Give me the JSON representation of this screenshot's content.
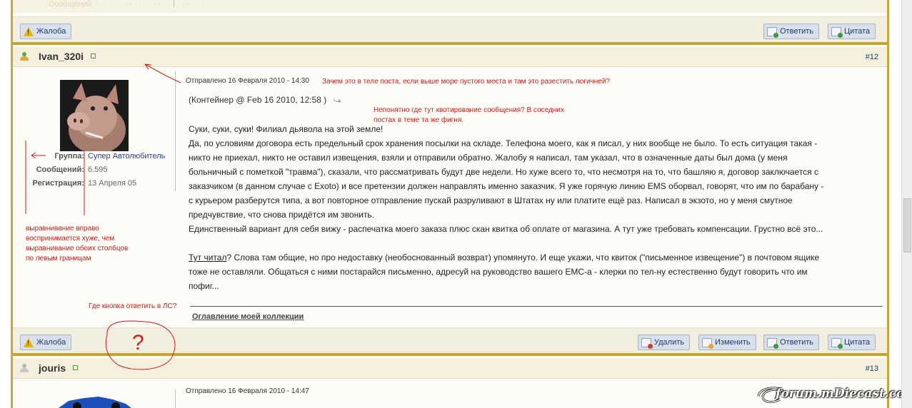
{
  "top_strip": {
    "faint_text": "Сообщений: · · · · · · · · · · · · · · · · · · · · · · · ·"
  },
  "buttons": {
    "complaint": "Жалоба",
    "reply": "Ответить",
    "quote": "Цитата",
    "delete": "Удалить",
    "edit": "Изменить"
  },
  "post12": {
    "username": "Ivan_320i",
    "number": "#12",
    "sent": "Отправлено 16 Февраля 2010 - 14:30",
    "group_label": "Группа:",
    "group_value": "Супер Автолюбитель",
    "posts_label": "Сообщений:",
    "posts_value": "6.595",
    "reg_label": "Регистрация:",
    "reg_value": "13 Апреля 05",
    "quote_header": "(Контейнер @ Feb 16 2010, 12:58 )",
    "lines": [
      "Суки, суки, суки! Филиал дьявола на этой земле!",
      "Да, по условиям договора есть предельный срок хранения посылки на складе. Телефона моего, как я писал, у них вообще не было. То есть ситуация такая -",
      "никто не приехал, никто не оставил извещения, взяли и отправили обратно. Жалобу я написал, там указал, что в означенные даты был дома (у меня",
      "больничный с пометкой \"травма\"), сказали, что рассматривать будут две недели. Но хуже всего то, что несмотря на то, что башляю я, договор заключается с",
      "заказчиком (в данном случае с Exoto) и все претензии должен направлять именно заказчик. Я уже горячую линию EMS оборвал, говорят, что им по барабану -",
      "с курьером разберутся типа, а вот повторное отправление пускай разруливают в Штатах ну или платите ещё раз. Написал в экзото, но у меня смутное",
      "предчувствие, что снова придётся им звонить.",
      "Единственный вариант для себя вижу - распечатка моего заказа плюс скан квитка об оплате от магазина. А тут уже требовать компенсации. Грустно всё это..."
    ],
    "reply_link": "Тут читал",
    "reply_line1_rest": "? Слова там общие, но про недоставку (необоснованный возврат) упомянуто. И еще укажи, что квиток (\"письменное извещение\") в почтовом ящике",
    "reply_line2": "тоже не оставляли. Общаться с ними постарайся письменно, адресуй на руководство вашего ЕМС-а - клерки по тел-ну естественно будут говорить что им",
    "reply_line3": "пофиг...",
    "signature": "Оглавление моей коллекции"
  },
  "post13": {
    "username": "jouris",
    "number": "#13",
    "sent": "Отправлено 16 Февраля 2010 - 14:47"
  },
  "annotations": {
    "why_in_body": "Зачем это в теле поста, если выше море пустого места и там это разестить логичней?",
    "quote_unclear": [
      "Непонятно где тут квотирование сообщения? В соседних",
      "постах в теме та же фигня."
    ],
    "alignment": [
      "выравнивание вправо",
      "воспринимается хуже, чем",
      "выравнивание обоих столбцов",
      "по левым границам"
    ],
    "where_pm": "Где кнопка ответить в ЛС?",
    "question_mark": "?"
  },
  "watermark": "forum.mDiecast.com",
  "colors": {
    "gold_separator": "#c4a52d",
    "button_bg": "#d8e0ec",
    "link_blue": "#1e3b6b",
    "annotation_red": "#cc1e1e"
  }
}
